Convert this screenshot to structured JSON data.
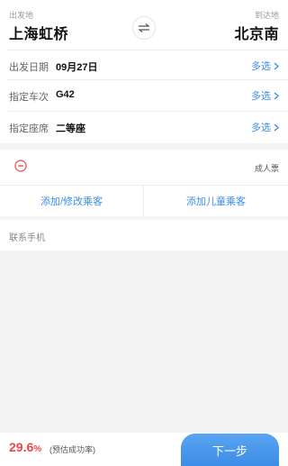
{
  "route": {
    "from_label": "出发地",
    "from_station": "上海虹桥",
    "to_label": "到达地",
    "to_station": "北京南"
  },
  "details": [
    {
      "label": "出发日期",
      "value": "09月27日",
      "action": "多选"
    },
    {
      "label": "指定车次",
      "value": "G42",
      "action": "多选"
    },
    {
      "label": "指定座席",
      "value": "二等座",
      "action": "多选"
    }
  ],
  "passengers": {
    "type_label": "成人票",
    "add_passenger": "添加/修改乘客",
    "add_child": "添加儿童乘客"
  },
  "contact": {
    "label": "联系手机"
  },
  "footer": {
    "rate": "29.6",
    "rate_unit": "%",
    "rate_note": "(预估成功率)",
    "next_label": "下一步"
  },
  "colors": {
    "accent": "#3b8de6",
    "danger": "#e8484b"
  },
  "icons": [
    "swap-icon",
    "chevron-right-icon",
    "remove-circle-icon"
  ]
}
